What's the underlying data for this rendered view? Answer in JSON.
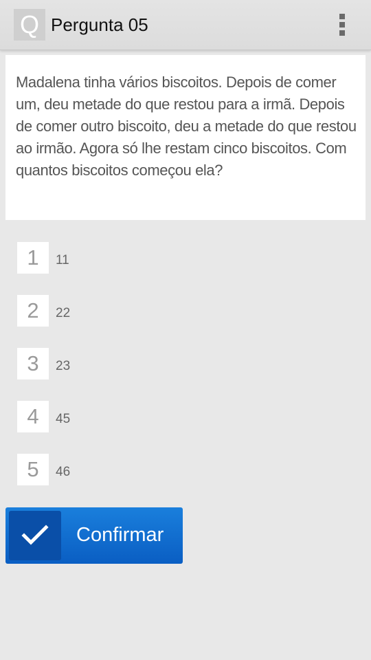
{
  "action_bar": {
    "icon_letter": "Q",
    "title": "Pergunta 05",
    "overflow_icon": "overflow-menu-icon"
  },
  "question": {
    "text": "Madalena tinha vários biscoitos. Depois de comer um, deu metade do que restou para a irmã. Depois de comer outro biscoito, deu a metade do que restou ao irmão. Agora só lhe restam cinco biscoitos. Com quantos biscoitos começou ela?"
  },
  "options": [
    {
      "number": "1",
      "value": "11"
    },
    {
      "number": "2",
      "value": "22"
    },
    {
      "number": "3",
      "value": "23"
    },
    {
      "number": "4",
      "value": "45"
    },
    {
      "number": "5",
      "value": "46"
    }
  ],
  "confirm": {
    "label": "Confirmar",
    "icon": "checkmark-icon",
    "color": "#1272d4"
  }
}
